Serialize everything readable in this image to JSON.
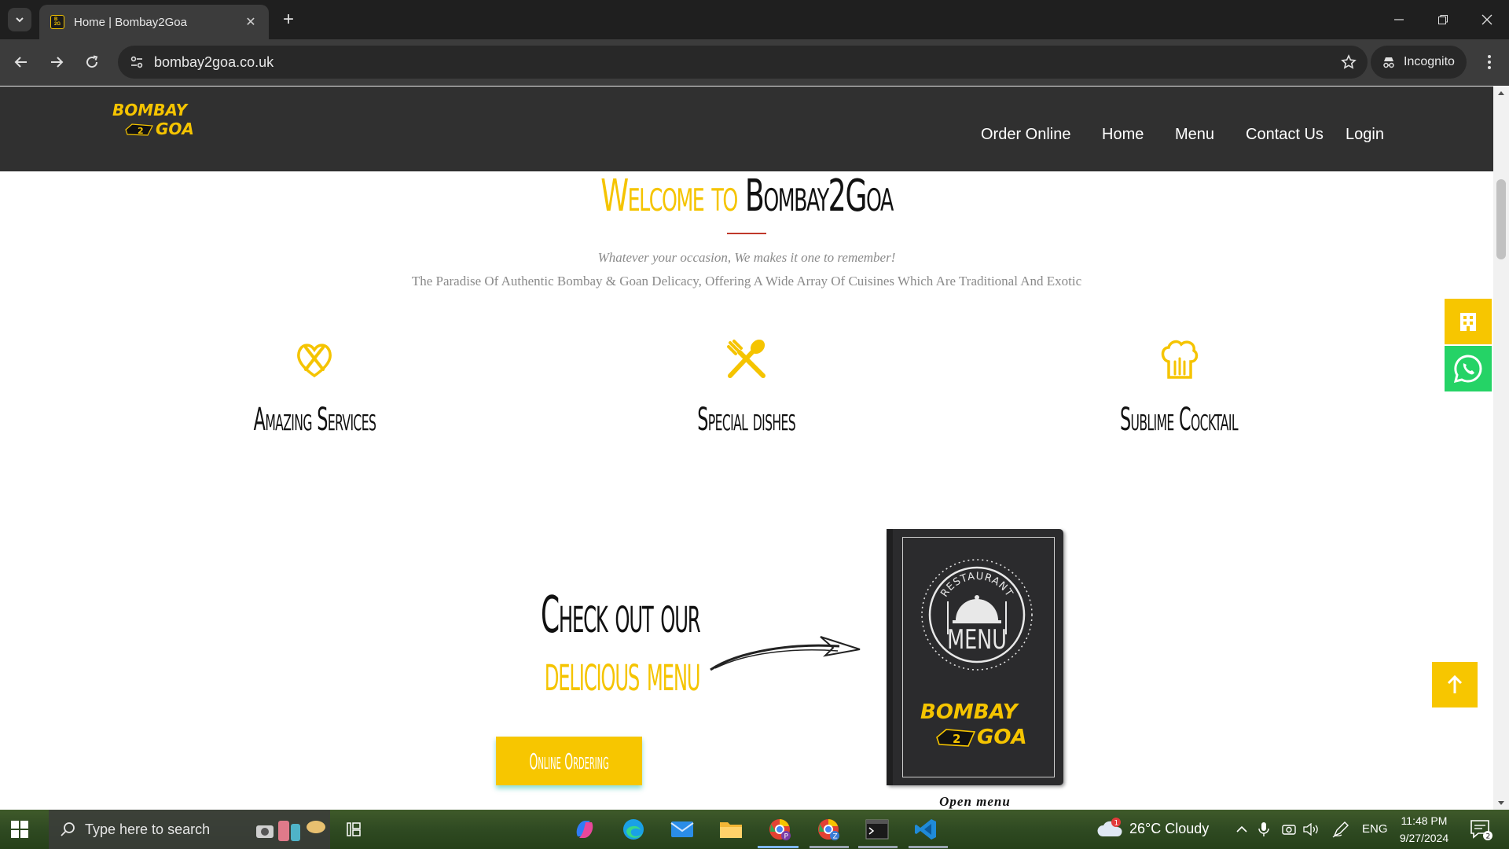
{
  "browser": {
    "tab_title": "Home | Bombay2Goa",
    "url": "bombay2goa.co.uk",
    "incognito_label": "Incognito"
  },
  "site": {
    "logo_top": "BOMBAY",
    "logo_mid": "2",
    "logo_bottom": "GOA",
    "nav": [
      "Order Online",
      "Home",
      "Menu",
      "Contact Us",
      "Login"
    ],
    "welcome_prefix": "Welcome to",
    "welcome_brand": "Bombay2Goa",
    "tagline": "Whatever your occasion, We makes it one to remember!",
    "subline": "The Paradise Of Authentic Bombay & Goan Delicacy, Offering A Wide Array Of Cuisines Which Are Traditional And Exotic",
    "features": [
      {
        "icon": "cutlery-heart-icon",
        "title": "Amazing Services"
      },
      {
        "icon": "crossed-fork-spoon-icon",
        "title": "Special dishes"
      },
      {
        "icon": "chef-hat-icon",
        "title": "Sublime Cocktail"
      }
    ],
    "checkout_line1": "Check out our",
    "checkout_line2": "delicious menu",
    "order_button": "Online Ordering",
    "menu_card": {
      "badge_top": "RESTAURANT",
      "badge_main": "MENU",
      "logo_top": "BOMBAY",
      "logo_mid": "2",
      "logo_bottom": "GOA"
    },
    "open_menu": "Open menu"
  },
  "taskbar": {
    "search_placeholder": "Type here to search",
    "weather": "26°C  Cloudy",
    "weather_badge": "1",
    "language": "ENG",
    "time": "11:48 PM",
    "date": "9/27/2024",
    "notification_count": "2"
  },
  "colors": {
    "brand_yellow": "#f5c400",
    "header_bg": "#303030",
    "whatsapp_green": "#25d366",
    "divider_red": "#c0392b"
  }
}
